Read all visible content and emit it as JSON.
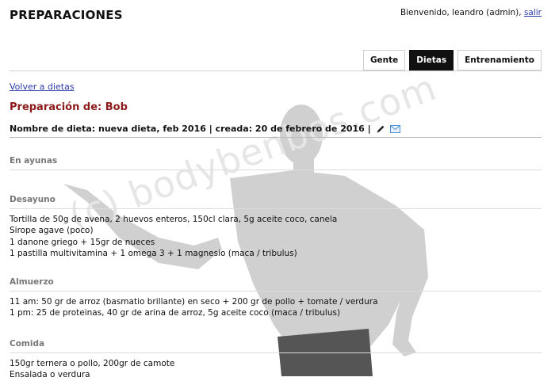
{
  "header": {
    "title": "PREPARACIONES",
    "welcome": "Bienvenido, leandro (admin),",
    "logout_label": "salir"
  },
  "tabs": [
    {
      "label": "Gente",
      "active": false
    },
    {
      "label": "Dietas",
      "active": true
    },
    {
      "label": "Entrenamiento",
      "active": false
    }
  ],
  "back_link": "Volver a dietas",
  "preparation_title": "Preparación de: Bob",
  "diet_info": "Nombre de dieta: nueva dieta, feb 2016 | creada: 20 de febrero de 2016 |",
  "icons": {
    "edit": "pencil-icon",
    "email": "envelope-icon"
  },
  "watermark": "(c) bodybenbos.com",
  "sections": [
    {
      "title": "En ayunas",
      "lines": []
    },
    {
      "title": "Desayuno",
      "lines": [
        "Tortilla de 50g de avena, 2 huevos enteros, 150cl clara, 5g aceite coco, canela",
        "Sirope agave (poco)",
        "1 danone griego + 15gr de nueces",
        "1 pastilla multivitamina + 1 omega 3 + 1 magnesio (maca / tribulus)"
      ]
    },
    {
      "title": "Almuerzo",
      "lines": [
        "11 am: 50 gr de arroz (basmatio brillante) en seco + 200 gr de pollo + tomate / verdura",
        "1 pm: 25 de proteinas, 40 gr de arina de arroz, 5g aceite coco (maca / tribulus)"
      ]
    },
    {
      "title": "Comida",
      "lines": [
        "150gr ternera o pollo, 200gr de camote",
        "Ensalada o verdura"
      ]
    }
  ],
  "colors": {
    "accent_red": "#8b1a1a",
    "link_blue": "#2a3aa8",
    "active_tab": "#111111"
  }
}
